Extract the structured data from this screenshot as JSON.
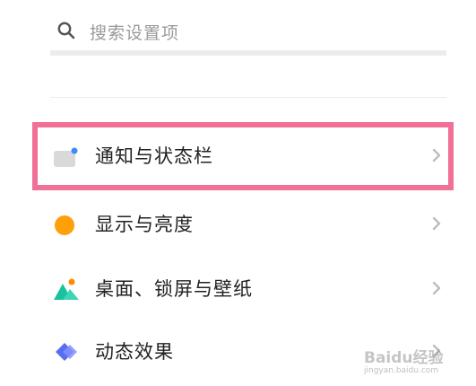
{
  "search": {
    "placeholder": "搜索设置项",
    "icon": "search-icon"
  },
  "settings": [
    {
      "label": "通知与状态栏",
      "icon": "notification-statusbar-icon",
      "highlighted": true
    },
    {
      "label": "显示与亮度",
      "icon": "display-brightness-icon"
    },
    {
      "label": "桌面、锁屏与壁纸",
      "icon": "desktop-wallpaper-icon"
    },
    {
      "label": "动态效果",
      "icon": "motion-effects-icon"
    }
  ],
  "colors": {
    "highlight": "#f07097",
    "brightness": "#ff9f0a",
    "wallpaper_teal": "#18c29c",
    "wallpaper_orange": "#ff8a00",
    "motion_blue": "#5a6cf0",
    "notification_dot": "#3d8bfd",
    "chevron": "#bdbdbd"
  },
  "watermark": {
    "text": "Baidu经验",
    "sub": "jingyan.baidu.com"
  }
}
